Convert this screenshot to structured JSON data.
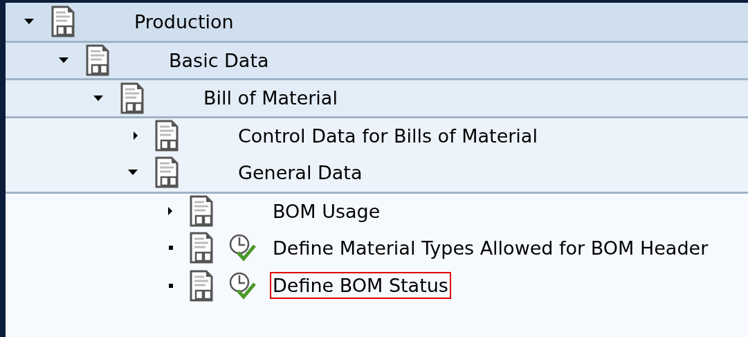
{
  "tree": [
    {
      "kind": "node",
      "label": "Production",
      "expanded": true,
      "children": [
        {
          "kind": "node",
          "label": "Basic Data",
          "expanded": true,
          "children": [
            {
              "kind": "node",
              "label": "Bill of Material",
              "expanded": true,
              "children": [
                {
                  "kind": "node",
                  "label": "Control Data for Bills of Material",
                  "expanded": false
                },
                {
                  "kind": "node",
                  "label": "General Data",
                  "expanded": true,
                  "children": [
                    {
                      "kind": "node",
                      "label": "BOM Usage",
                      "expanded": false
                    },
                    {
                      "kind": "activity",
                      "label": "Define Material Types Allowed for BOM Header",
                      "selected": false
                    },
                    {
                      "kind": "activity",
                      "label": "Define BOM Status",
                      "selected": true
                    }
                  ]
                }
              ]
            }
          ]
        }
      ]
    }
  ]
}
